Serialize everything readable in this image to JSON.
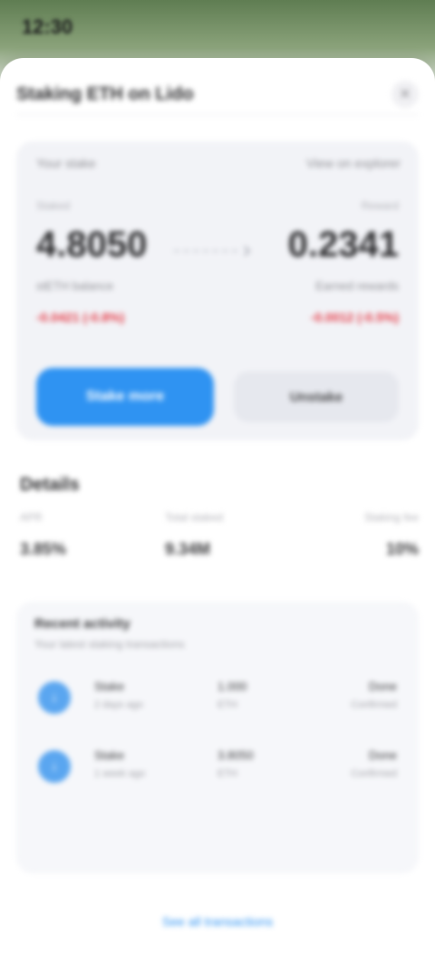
{
  "status_bar": {
    "time": "12:30"
  },
  "sheet": {
    "title": "Staking ETH on Lido",
    "close_label": "✕"
  },
  "summary": {
    "label": "Your stake",
    "link": "View on explorer",
    "left": {
      "caption": "Staked",
      "value": "4.8050",
      "sub": "stETH balance",
      "delta": "-0.0421 (-0.8%)"
    },
    "right": {
      "caption": "Reward",
      "value": "0.2341",
      "sub": "Earned rewards",
      "delta": "-0.0012 (-0.5%)"
    },
    "primary_button": "Stake more",
    "secondary_button": "Unstake"
  },
  "details": {
    "title": "Details",
    "stats": [
      {
        "label": "APR",
        "value": "3.85%"
      },
      {
        "label": "Total staked",
        "value": "9.34M"
      },
      {
        "label": "Staking fee",
        "value": "10%"
      }
    ]
  },
  "activity": {
    "title": "Recent activity",
    "subtitle": "Your latest staking transactions",
    "rows": [
      {
        "icon": "↓",
        "name": "Stake",
        "time": "2 days ago",
        "amount": "1.000",
        "token": "ETH",
        "status": "Done",
        "status_sub": "Confirmed"
      },
      {
        "icon": "↓",
        "name": "Stake",
        "time": "1 week ago",
        "amount": "3.8050",
        "token": "ETH",
        "status": "Done",
        "status_sub": "Confirmed"
      }
    ]
  },
  "footer": {
    "link": "See all transactions"
  },
  "colors": {
    "accent": "#2f93f2",
    "negative": "#e53945"
  }
}
